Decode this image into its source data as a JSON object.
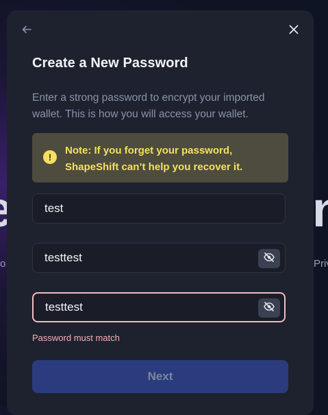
{
  "background": {
    "left_letter": "e",
    "left_small": "o",
    "right_letter": "n",
    "right_small": "Priv"
  },
  "modal": {
    "back_icon": "arrow-left-icon",
    "close_icon": "close-icon",
    "title": "Create a New Password",
    "description": "Enter a strong password to encrypt your imported wallet. This is how you will access your wallet."
  },
  "alert": {
    "icon": "exclamation-icon",
    "text": "Note: If you forget your password, ShapeShift can’t help you recover it."
  },
  "fields": {
    "name_value": "test",
    "password_value": "testtest",
    "confirm_value": "testtest",
    "eye_icon": "eye-slash-icon"
  },
  "error": {
    "text": "Password must match"
  },
  "next_button": {
    "label": "Next"
  },
  "colors": {
    "modal_bg": "#1e222e",
    "alert_bg": "#4d4c3f",
    "alert_text": "#f6e05e",
    "error_border": "#f1bcc3",
    "button_bg": "#2a3c7e"
  }
}
